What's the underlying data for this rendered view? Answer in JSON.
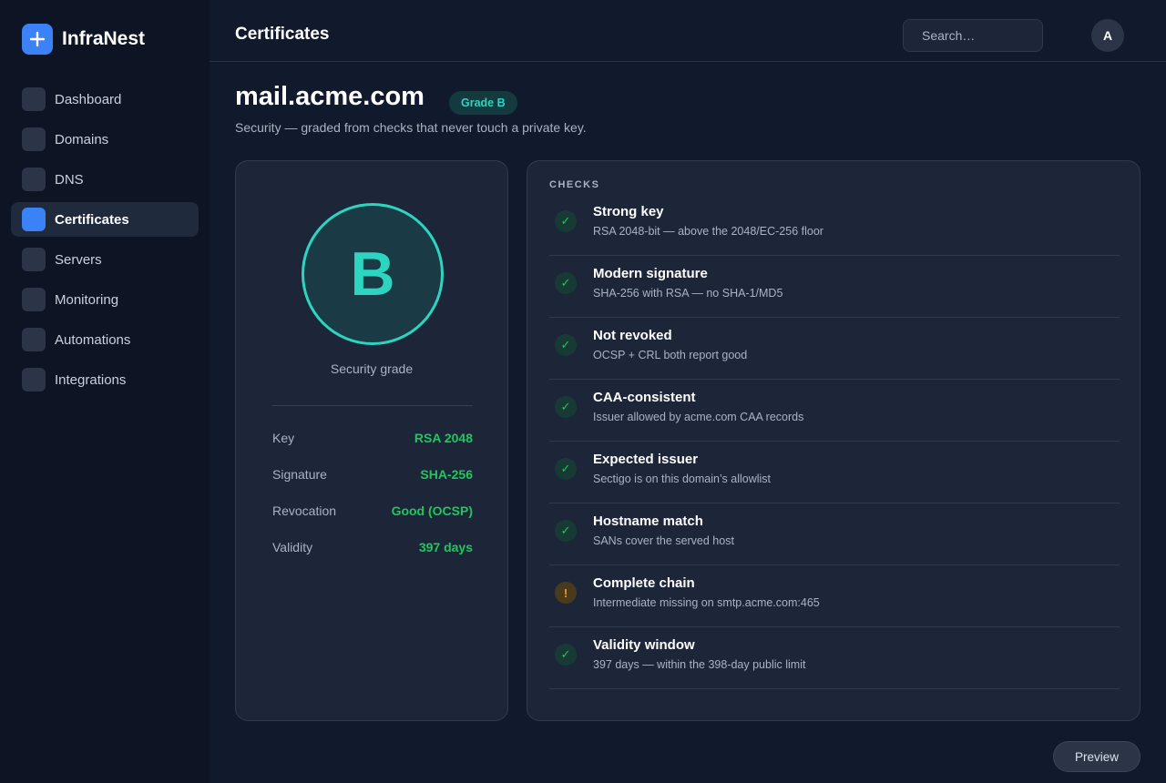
{
  "brand": {
    "name": "InfraNest",
    "logo_icon": "plus-icon",
    "accent": "#3b82f6"
  },
  "sidebar": {
    "items": [
      {
        "label": "Dashboard",
        "active": false
      },
      {
        "label": "Domains",
        "active": false
      },
      {
        "label": "DNS",
        "active": false
      },
      {
        "label": "Certificates",
        "active": true
      },
      {
        "label": "Servers",
        "active": false
      },
      {
        "label": "Monitoring",
        "active": false
      },
      {
        "label": "Automations",
        "active": false
      },
      {
        "label": "Integrations",
        "active": false
      }
    ]
  },
  "header": {
    "title": "Certificates",
    "search_placeholder": "Search…",
    "avatar_initial": "A"
  },
  "page": {
    "title": "mail.acme.com",
    "grade_badge": "Grade B",
    "subtitle": "Security — graded from checks that never touch a private key."
  },
  "grade_card": {
    "letter": "B",
    "caption": "Security grade",
    "color": "#2dd4bf",
    "summary": [
      {
        "label": "Key",
        "value": "RSA 2048"
      },
      {
        "label": "Signature",
        "value": "SHA-256"
      },
      {
        "label": "Revocation",
        "value": "Good (OCSP)"
      },
      {
        "label": "Validity",
        "value": "397 days"
      }
    ]
  },
  "checks": {
    "heading": "CHECKS",
    "items": [
      {
        "title": "Strong key",
        "desc": "RSA 2048-bit — above the 2048/EC-256 floor",
        "status": "ok",
        "icon": "check-icon"
      },
      {
        "title": "Modern signature",
        "desc": "SHA-256 with RSA — no SHA-1/MD5",
        "status": "ok",
        "icon": "check-icon"
      },
      {
        "title": "Not revoked",
        "desc": "OCSP + CRL both report good",
        "status": "ok",
        "icon": "check-icon"
      },
      {
        "title": "CAA-consistent",
        "desc": "Issuer allowed by acme.com CAA records",
        "status": "ok",
        "icon": "check-icon"
      },
      {
        "title": "Expected issuer",
        "desc": "Sectigo is on this domain’s allowlist",
        "status": "ok",
        "icon": "check-icon"
      },
      {
        "title": "Hostname match",
        "desc": "SANs cover the served host",
        "status": "ok",
        "icon": "check-icon"
      },
      {
        "title": "Complete chain",
        "desc": "Intermediate missing on smtp.acme.com:465",
        "status": "warn",
        "icon": "warning-icon"
      },
      {
        "title": "Validity window",
        "desc": "397 days — within the 398-day public limit",
        "status": "ok",
        "icon": "check-icon"
      }
    ]
  },
  "footer": {
    "preview_label": "Preview"
  },
  "colors": {
    "ok": "#22c55e",
    "warn": "#f59e0b",
    "background": "#111a2c"
  }
}
